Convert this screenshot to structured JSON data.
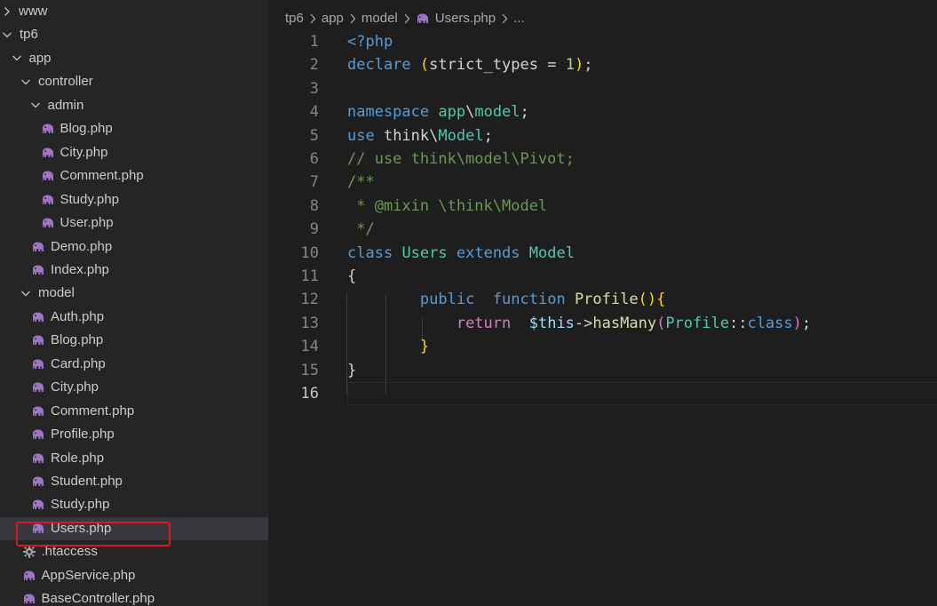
{
  "explorer": {
    "items": [
      {
        "label": "www",
        "type": "folder",
        "state": "collapsed",
        "depth": 0,
        "icon": "chevron-right-icon"
      },
      {
        "label": "tp6",
        "type": "folder",
        "state": "expanded",
        "depth": 0,
        "icon": "chevron-down-icon"
      },
      {
        "label": "app",
        "type": "folder",
        "state": "expanded",
        "depth": 1,
        "icon": "chevron-down-icon"
      },
      {
        "label": "controller",
        "type": "folder",
        "state": "expanded",
        "depth": 2,
        "icon": "chevron-down-icon"
      },
      {
        "label": "admin",
        "type": "folder",
        "state": "expanded",
        "depth": 3,
        "icon": "chevron-down-icon"
      },
      {
        "label": "Blog.php",
        "type": "file",
        "depth": 4,
        "icon": "php-elephant-icon"
      },
      {
        "label": "City.php",
        "type": "file",
        "depth": 4,
        "icon": "php-elephant-icon"
      },
      {
        "label": "Comment.php",
        "type": "file",
        "depth": 4,
        "icon": "php-elephant-icon"
      },
      {
        "label": "Study.php",
        "type": "file",
        "depth": 4,
        "icon": "php-elephant-icon"
      },
      {
        "label": "User.php",
        "type": "file",
        "depth": 4,
        "icon": "php-elephant-icon"
      },
      {
        "label": "Demo.php",
        "type": "file",
        "depth": 3,
        "icon": "php-elephant-icon"
      },
      {
        "label": "Index.php",
        "type": "file",
        "depth": 3,
        "icon": "php-elephant-icon"
      },
      {
        "label": "model",
        "type": "folder",
        "state": "expanded",
        "depth": 2,
        "icon": "chevron-down-icon"
      },
      {
        "label": "Auth.php",
        "type": "file",
        "depth": 3,
        "icon": "php-elephant-icon"
      },
      {
        "label": "Blog.php",
        "type": "file",
        "depth": 3,
        "icon": "php-elephant-icon"
      },
      {
        "label": "Card.php",
        "type": "file",
        "depth": 3,
        "icon": "php-elephant-icon"
      },
      {
        "label": "City.php",
        "type": "file",
        "depth": 3,
        "icon": "php-elephant-icon"
      },
      {
        "label": "Comment.php",
        "type": "file",
        "depth": 3,
        "icon": "php-elephant-icon"
      },
      {
        "label": "Profile.php",
        "type": "file",
        "depth": 3,
        "icon": "php-elephant-icon"
      },
      {
        "label": "Role.php",
        "type": "file",
        "depth": 3,
        "icon": "php-elephant-icon"
      },
      {
        "label": "Student.php",
        "type": "file",
        "depth": 3,
        "icon": "php-elephant-icon"
      },
      {
        "label": "Study.php",
        "type": "file",
        "depth": 3,
        "icon": "php-elephant-icon"
      },
      {
        "label": "Users.php",
        "type": "file",
        "depth": 3,
        "icon": "php-elephant-icon",
        "selected": true,
        "highlighted": true
      },
      {
        "label": ".htaccess",
        "type": "file",
        "depth": 2,
        "icon": "gear-icon"
      },
      {
        "label": "AppService.php",
        "type": "file",
        "depth": 2,
        "icon": "php-elephant-icon"
      },
      {
        "label": "BaseController.php",
        "type": "file",
        "depth": 2,
        "icon": "php-elephant-icon"
      }
    ]
  },
  "breadcrumb": {
    "items": [
      "tp6",
      "app",
      "model",
      "Users.php",
      "..."
    ],
    "file_icon": "php-elephant-icon",
    "separator_icon": "chevron-right-icon"
  },
  "editor": {
    "current_line": 16,
    "lines": [
      {
        "n": "1",
        "tokens": [
          [
            "kw",
            "<?php"
          ]
        ]
      },
      {
        "n": "2",
        "tokens": [
          [
            "kw",
            "declare"
          ],
          [
            "txt",
            " "
          ],
          [
            "br",
            "("
          ],
          [
            "txt",
            "strict_types = "
          ],
          [
            "num",
            "1"
          ],
          [
            "br",
            ")"
          ],
          [
            "txt",
            ";"
          ]
        ]
      },
      {
        "n": "3",
        "tokens": []
      },
      {
        "n": "4",
        "tokens": [
          [
            "kw",
            "namespace"
          ],
          [
            "txt",
            " "
          ],
          [
            "cls",
            "app"
          ],
          [
            "txt",
            "\\"
          ],
          [
            "cls",
            "model"
          ],
          [
            "txt",
            ";"
          ]
        ]
      },
      {
        "n": "5",
        "tokens": [
          [
            "kw",
            "use"
          ],
          [
            "txt",
            " think\\"
          ],
          [
            "cls",
            "Model"
          ],
          [
            "txt",
            ";"
          ]
        ]
      },
      {
        "n": "6",
        "tokens": [
          [
            "cmt",
            "// use think\\model\\Pivot;"
          ]
        ]
      },
      {
        "n": "7",
        "tokens": [
          [
            "cmt",
            "/**"
          ]
        ]
      },
      {
        "n": "8",
        "tokens": [
          [
            "cmt",
            " * @mixin \\think\\Model"
          ]
        ]
      },
      {
        "n": "9",
        "tokens": [
          [
            "cmt",
            " */"
          ]
        ]
      },
      {
        "n": "10",
        "tokens": [
          [
            "kw",
            "class"
          ],
          [
            "txt",
            " "
          ],
          [
            "cls",
            "Users"
          ],
          [
            "txt",
            " "
          ],
          [
            "kw",
            "extends"
          ],
          [
            "txt",
            " "
          ],
          [
            "cls",
            "Model"
          ]
        ]
      },
      {
        "n": "11",
        "tokens": [
          [
            "txt",
            "{"
          ]
        ]
      },
      {
        "n": "12",
        "tokens": [
          [
            "txt",
            "        "
          ],
          [
            "kw",
            "public"
          ],
          [
            "txt",
            "  "
          ],
          [
            "kw",
            "function"
          ],
          [
            "txt",
            " "
          ],
          [
            "fn",
            "Profile"
          ],
          [
            "br",
            "()"
          ],
          [
            "br",
            "{"
          ]
        ]
      },
      {
        "n": "13",
        "tokens": [
          [
            "txt",
            "            "
          ],
          [
            "ctl",
            "return"
          ],
          [
            "txt",
            "  "
          ],
          [
            "var",
            "$this"
          ],
          [
            "txt",
            "->"
          ],
          [
            "fn",
            "hasMany"
          ],
          [
            "br2",
            "("
          ],
          [
            "cls",
            "Profile"
          ],
          [
            "txt",
            "::"
          ],
          [
            "kw",
            "class"
          ],
          [
            "br2",
            ")"
          ],
          [
            "txt",
            ";"
          ]
        ]
      },
      {
        "n": "14",
        "tokens": [
          [
            "txt",
            "        "
          ],
          [
            "br",
            "}"
          ]
        ]
      },
      {
        "n": "15",
        "tokens": [
          [
            "txt",
            "}"
          ]
        ]
      },
      {
        "n": "16",
        "tokens": []
      }
    ]
  },
  "colors": {
    "sidebar_bg": "#252526",
    "editor_bg": "#1e1e1e",
    "selected_row_bg": "#37373d",
    "highlight_border": "#e0181e",
    "php_icon": "#a074c4"
  }
}
